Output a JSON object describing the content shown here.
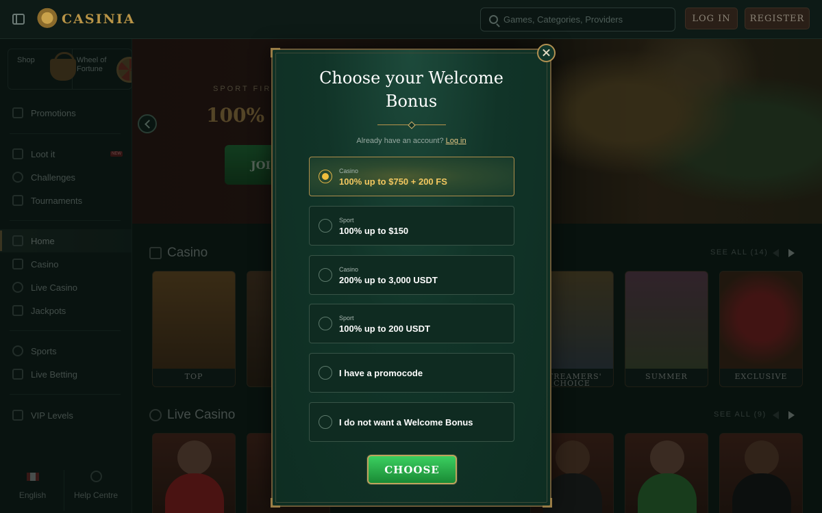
{
  "header": {
    "brand": "CASINIA",
    "search_placeholder": "Games, Categories, Providers",
    "login_label": "LOG IN",
    "register_label": "REGISTER"
  },
  "sidebar": {
    "quick": [
      {
        "label": "Shop",
        "icon": "basket-icon"
      },
      {
        "label": "Wheel of Fortune",
        "icon": "wheel-icon"
      }
    ],
    "promotions": "Promotions",
    "loot_it": "Loot it",
    "new_badge": "NEW",
    "challenges": "Challenges",
    "tournaments": "Tournaments",
    "home": "Home",
    "casino": "Casino",
    "live_casino": "Live Casino",
    "jackpots": "Jackpots",
    "sports": "Sports",
    "live_betting": "Live Betting",
    "vip_levels": "VIP Levels",
    "language": "English",
    "help": "Help Centre"
  },
  "hero": {
    "subtitle": "SPORT FIRS",
    "title": "100% u",
    "cta": "JOI"
  },
  "casino_section": {
    "title": "Casino",
    "see_all": "SEE ALL (14)",
    "cards": [
      "TOP",
      "STREAMERS' CHOICE",
      "SUMMER",
      "EXCLUSIVE"
    ]
  },
  "live_section": {
    "title": "Live Casino",
    "see_all": "SEE ALL (9)"
  },
  "modal": {
    "title": "Choose your Welcome Bonus",
    "already_text": "Already have an account?",
    "login_link": "Log in",
    "options": [
      {
        "category": "Casino",
        "label": "100% up to $750 + 200 FS",
        "selected": true
      },
      {
        "category": "Sport",
        "label": "100% up to $150",
        "selected": false
      },
      {
        "category": "Casino",
        "label": "200% up to 3,000 USDT",
        "selected": false
      },
      {
        "category": "Sport",
        "label": "100% up to 200 USDT",
        "selected": false
      },
      {
        "category": "",
        "label": "I have a promocode",
        "selected": false
      },
      {
        "category": "",
        "label": "I do not want a Welcome Bonus",
        "selected": false
      }
    ],
    "choose_label": "CHOOSE"
  },
  "colors": {
    "accent_gold": "#f0be3d",
    "choose_green": "#2bb04a",
    "modal_bg": "#113428"
  }
}
